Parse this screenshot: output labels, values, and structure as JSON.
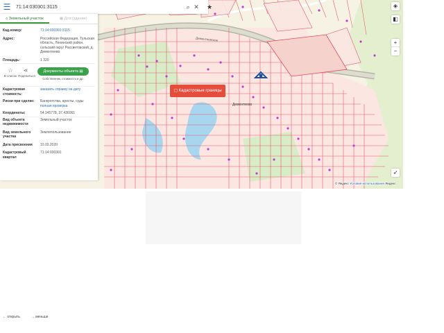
{
  "search": {
    "value": "71:14:030301:3115"
  },
  "tabs": [
    {
      "label": "Земельный участок"
    },
    {
      "label": "Для (здание)"
    }
  ],
  "info": {
    "cad_num_label": "Кад.номер:",
    "cad_num_value": "71:14:030301:3115",
    "address_label": "Адрес:",
    "address_value": "Российская Федерация, Тульская область, Ленинский район, сельский округ Рассветовский, д. Дементеево",
    "area_label": "Площадь:",
    "area_value": "1 320"
  },
  "actions": {
    "in_list": "В список",
    "share": "Поделиться",
    "docs_button": "Документы объекта",
    "docs_sub": "Собственник, стоимость и др."
  },
  "details": {
    "cost_label": "Кадастровая стоимость:",
    "cost_value": "заказать справку на дату",
    "risks_label": "Риски при сделке:",
    "risks_value": "Банкротства, аресты, суды",
    "risks_link": "полная проверка",
    "coords_label": "Координаты:",
    "coords_value": "54.145778, 37.436061",
    "obj_type_label": "Вид объекта недвижимости",
    "obj_type_value": "Земельный участок",
    "land_type_label": "Вид земельного участка",
    "land_type_value": "Землепользование",
    "date_label": "Дата присвоения",
    "date_value": "10.02.2020",
    "quarter_label": "Кадастровый квартал",
    "quarter_value": "71:14:030301"
  },
  "map": {
    "cadastral_button": "Кадастровые границы",
    "road_label": "Дементеевское",
    "village_label": "Дементеево",
    "attribution_yandex": "© Яндекс",
    "attribution_link": "Условия использования",
    "attribution_brand": "Яндекс"
  },
  "bottom_nav": {
    "left": "← открыть",
    "right": "→ меньше"
  },
  "colors": {
    "accent": "#3aa24a",
    "cad_button": "#e64c3c",
    "parcel": "#e8435a",
    "plot_fill": "#fdeae6",
    "link": "#2f6db3"
  }
}
